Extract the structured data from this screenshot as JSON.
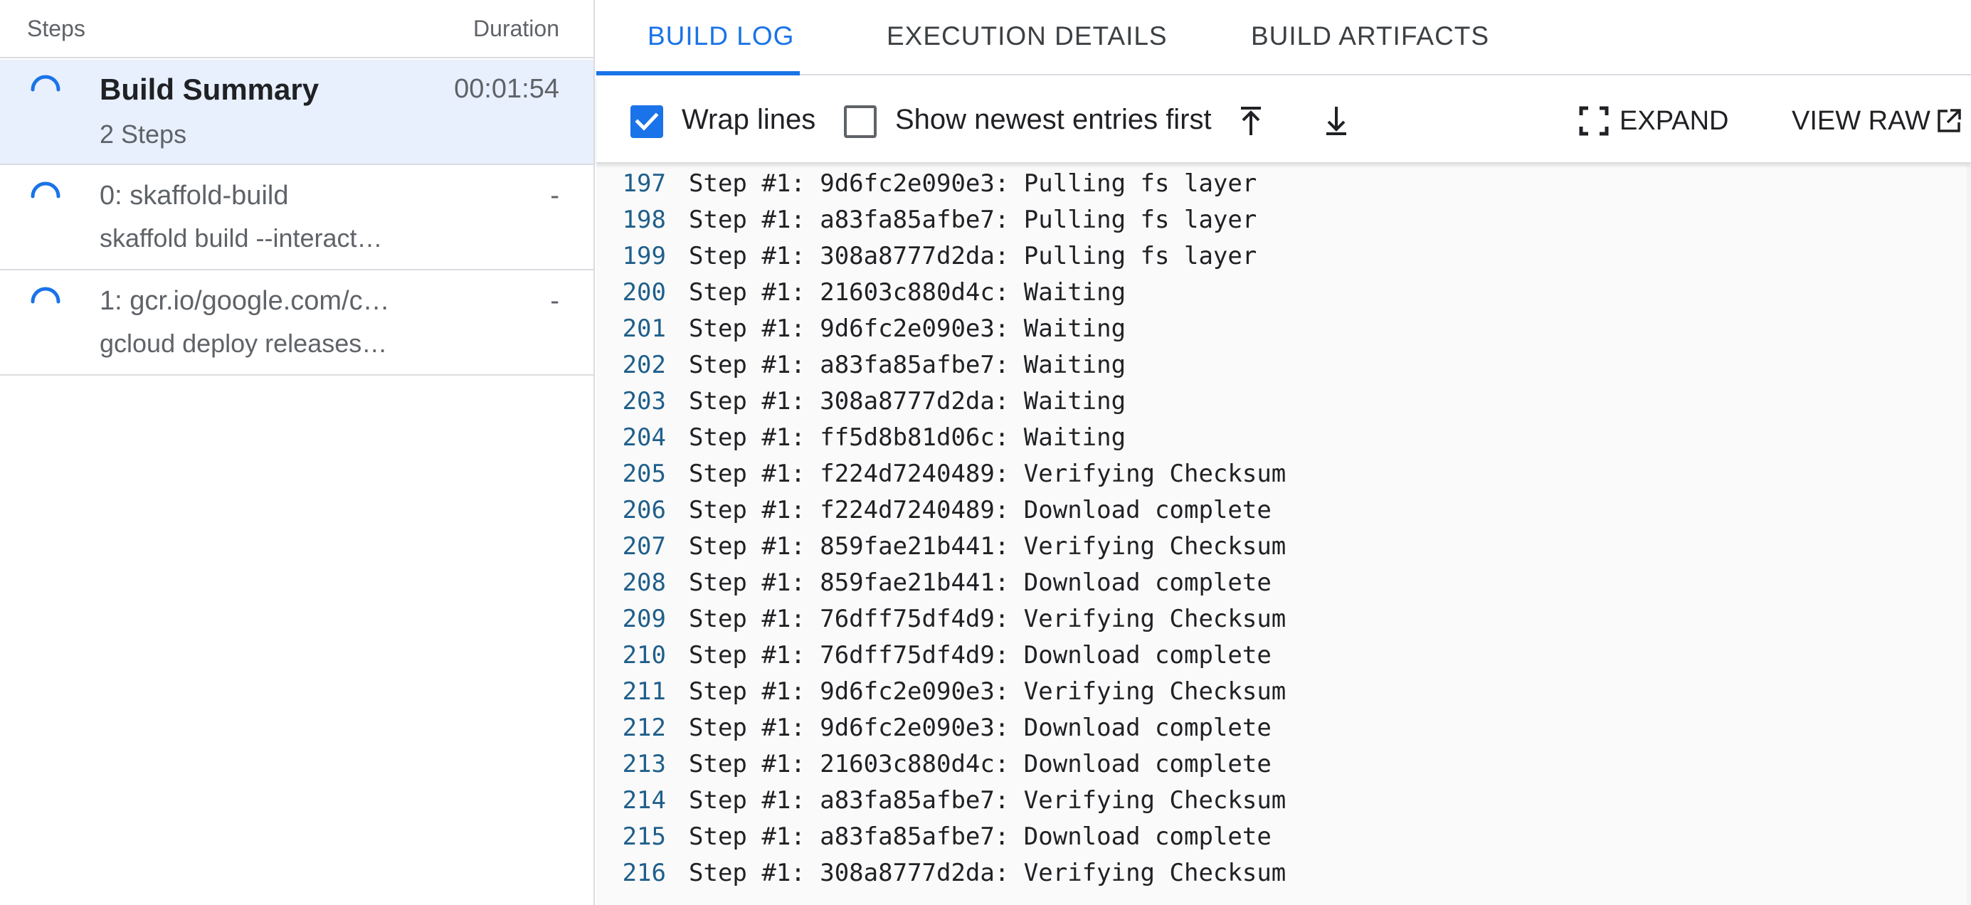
{
  "colors": {
    "accent": "#1a73e8",
    "selected_row_bg": "#e8f0fe",
    "line_number": "#1f5f8b",
    "divider": "#dadce0"
  },
  "steps_panel": {
    "header_steps": "Steps",
    "header_duration": "Duration",
    "items": [
      {
        "title": "Build Summary",
        "subtitle": "2 Steps",
        "duration": "00:01:54",
        "icon": "loading-spinner-icon",
        "selected": true
      },
      {
        "title": "0: skaffold-build",
        "subtitle": "skaffold build --interact…",
        "duration": "-",
        "icon": "loading-spinner-icon",
        "selected": false
      },
      {
        "title": "1: gcr.io/google.com/c…",
        "subtitle": "gcloud deploy releases…",
        "duration": "-",
        "icon": "loading-spinner-icon",
        "selected": false
      }
    ]
  },
  "tabs": [
    {
      "label": "BUILD LOG",
      "active": true
    },
    {
      "label": "EXECUTION DETAILS",
      "active": false
    },
    {
      "label": "BUILD ARTIFACTS",
      "active": false
    }
  ],
  "toolbar": {
    "wrap_lines_label": "Wrap lines",
    "wrap_lines_checked": true,
    "newest_first_label": "Show newest entries first",
    "newest_first_checked": false,
    "scroll_top_icon": "scroll-to-top-icon",
    "scroll_bottom_icon": "scroll-to-bottom-icon",
    "expand_label": "EXPAND",
    "expand_icon": "fullscreen-icon",
    "view_raw_label": "VIEW RAW",
    "view_raw_icon": "open-in-new-icon"
  },
  "log": {
    "lines": [
      {
        "n": "197",
        "text": "Step #1: 9d6fc2e090e3: Pulling fs layer"
      },
      {
        "n": "198",
        "text": "Step #1: a83fa85afbe7: Pulling fs layer"
      },
      {
        "n": "199",
        "text": "Step #1: 308a8777d2da: Pulling fs layer"
      },
      {
        "n": "200",
        "text": "Step #1: 21603c880d4c: Waiting"
      },
      {
        "n": "201",
        "text": "Step #1: 9d6fc2e090e3: Waiting"
      },
      {
        "n": "202",
        "text": "Step #1: a83fa85afbe7: Waiting"
      },
      {
        "n": "203",
        "text": "Step #1: 308a8777d2da: Waiting"
      },
      {
        "n": "204",
        "text": "Step #1: ff5d8b81d06c: Waiting"
      },
      {
        "n": "205",
        "text": "Step #1: f224d7240489: Verifying Checksum"
      },
      {
        "n": "206",
        "text": "Step #1: f224d7240489: Download complete"
      },
      {
        "n": "207",
        "text": "Step #1: 859fae21b441: Verifying Checksum"
      },
      {
        "n": "208",
        "text": "Step #1: 859fae21b441: Download complete"
      },
      {
        "n": "209",
        "text": "Step #1: 76dff75df4d9: Verifying Checksum"
      },
      {
        "n": "210",
        "text": "Step #1: 76dff75df4d9: Download complete"
      },
      {
        "n": "211",
        "text": "Step #1: 9d6fc2e090e3: Verifying Checksum"
      },
      {
        "n": "212",
        "text": "Step #1: 9d6fc2e090e3: Download complete"
      },
      {
        "n": "213",
        "text": "Step #1: 21603c880d4c: Download complete"
      },
      {
        "n": "214",
        "text": "Step #1: a83fa85afbe7: Verifying Checksum"
      },
      {
        "n": "215",
        "text": "Step #1: a83fa85afbe7: Download complete"
      },
      {
        "n": "216",
        "text": "Step #1: 308a8777d2da: Verifying Checksum"
      }
    ]
  }
}
